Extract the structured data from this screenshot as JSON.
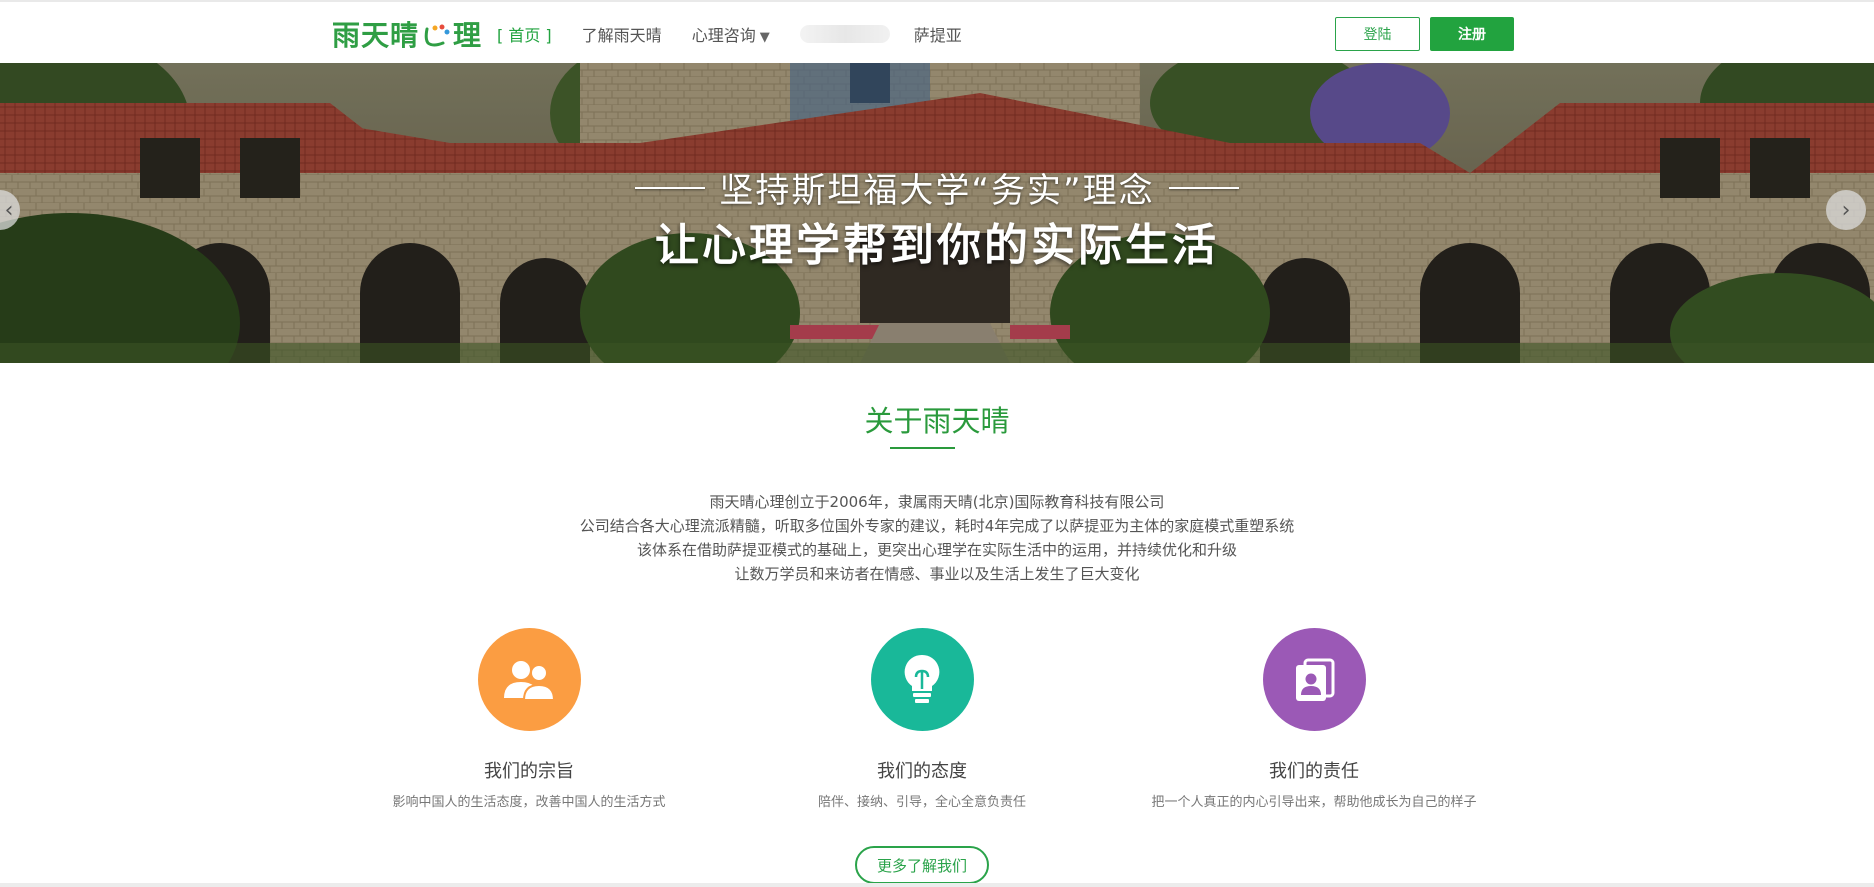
{
  "nav": {
    "logo_part1": "雨天晴",
    "logo_part2": "理",
    "items": [
      {
        "label": "[ 首页 ]",
        "active": true
      },
      {
        "label": "了解雨天晴"
      },
      {
        "label": "心理咨询",
        "has_dropdown": true,
        "arrow": "▼"
      },
      {
        "label": "萨提亚"
      }
    ],
    "login_label": "登陆",
    "register_label": "注册"
  },
  "banner": {
    "line1": "坚持斯坦福大学“务实”理念",
    "line2": "让心理学帮到你的实际生活",
    "prev_icon": "‹",
    "next_icon": "›"
  },
  "about": {
    "title": "关于雨天晴",
    "paragraphs": [
      "雨天晴心理创立于2006年，隶属雨天晴(北京)国际教育科技有限公司",
      "公司结合各大心理流派精髓，听取多位国外专家的建议，耗时4年完成了以萨提亚为主体的家庭模式重塑系统",
      "该体系在借助萨提亚模式的基础上，更突出心理学在实际生活中的运用，并持续优化和升级",
      "让数万学员和来访者在情感、事业以及生活上发生了巨大变化"
    ],
    "features": [
      {
        "title": "我们的宗旨",
        "desc": "影响中国人的生活态度，改善中国人的生活方式",
        "color": "#fb9d42",
        "icon": "users-icon"
      },
      {
        "title": "我们的态度",
        "desc": "陪伴、接纳、引导，全心全意负责任",
        "color": "#19b899",
        "icon": "lightbulb-icon"
      },
      {
        "title": "我们的责任",
        "desc": "把一个人真正的内心引导出来，帮助他成长为自己的样子",
        "color": "#9b59b6",
        "icon": "profile-card-icon"
      }
    ],
    "more_label": "更多了解我们"
  },
  "colors": {
    "brand_green": "#22a33f",
    "text_gray": "#555555"
  }
}
